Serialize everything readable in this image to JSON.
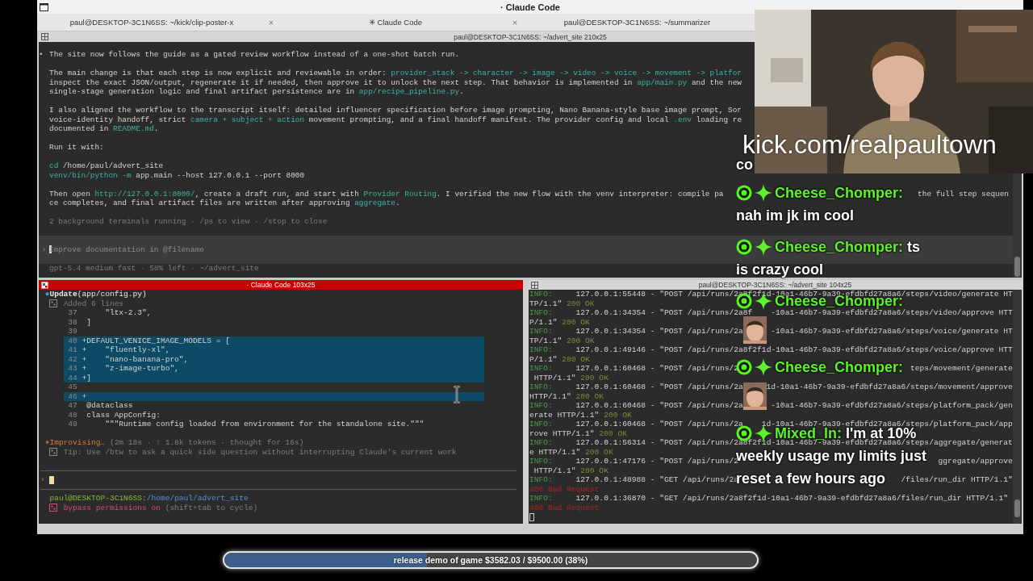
{
  "window": {
    "title": "· Claude Code"
  },
  "tabs": [
    {
      "label": "paul@DESKTOP-3C1N6SS: ~/kick/clip-poster-x",
      "close": "×"
    },
    {
      "label": "✳ Claude Code",
      "close": "×"
    },
    {
      "label": "paul@DESKTOP-3C1N6SS: ~/summarizer"
    }
  ],
  "top_pane": {
    "title": "paul@DESKTOP-3C1N6SS: ~/advert_site 210x25",
    "paragraphs": [
      [
        {
          "bullet": "•",
          "segments": [
            {
              "text": "The site now follows the guide as a gated review workflow instead of a one-shot batch run.",
              "kind": "plain"
            }
          ]
        }
      ],
      [
        {
          "segments": [
            {
              "text": "The main change is that each step is now explicit and reviewable in order: ",
              "kind": "plain"
            },
            {
              "text": "provider_stack -> character -> image -> video -> voice -> movement -> platfor",
              "kind": "accent"
            }
          ]
        },
        {
          "segments": [
            {
              "text": "inspect the exact JSON/output, regenerate it if needed, then approve it to unlock the next step. That behavior is implemented in ",
              "kind": "plain"
            },
            {
              "text": "app/main.py",
              "kind": "accent"
            },
            {
              "text": " and the new",
              "kind": "plain"
            }
          ]
        },
        {
          "segments": [
            {
              "text": "single-stage generation logic and final artifact persistence are in ",
              "kind": "plain"
            },
            {
              "text": "app/recipe_pipeline.py",
              "kind": "accent"
            },
            {
              "text": ".",
              "kind": "plain"
            }
          ]
        }
      ],
      [
        {
          "segments": [
            {
              "text": "I also aligned the workflow to the transcript itself: detailed influencer specification before image prompting, Nano Banana-style base image prompt, Sor",
              "kind": "plain"
            }
          ]
        },
        {
          "segments": [
            {
              "text": "voice-identity handoff, strict ",
              "kind": "plain"
            },
            {
              "text": "camera + subject + action",
              "kind": "accent"
            },
            {
              "text": " movement prompting, and a final handoff manifest. The provider config and local ",
              "kind": "plain"
            },
            {
              "text": ".env",
              "kind": "accent"
            },
            {
              "text": " loading re",
              "kind": "plain"
            }
          ]
        },
        {
          "segments": [
            {
              "text": "documented in ",
              "kind": "plain"
            },
            {
              "text": "README.md",
              "kind": "accent"
            },
            {
              "text": ".",
              "kind": "plain"
            }
          ]
        }
      ],
      [
        {
          "segments": [
            {
              "text": "Run it with:",
              "kind": "plain"
            }
          ]
        }
      ],
      [
        {
          "segments": [
            {
              "text": "cd",
              "kind": "accent"
            },
            {
              "text": " /home/paul/advert_site",
              "kind": "plain"
            }
          ]
        },
        {
          "segments": [
            {
              "text": "venv/bin/python -m",
              "kind": "accent"
            },
            {
              "text": " app.main --host 127.0.0.1 --port 8000",
              "kind": "plain"
            }
          ]
        }
      ],
      [
        {
          "segments": [
            {
              "text": "Then open ",
              "kind": "plain"
            },
            {
              "text": "http://127.0.0.1:8000/",
              "kind": "accent"
            },
            {
              "text": ", create a draft run, and start with ",
              "kind": "plain"
            },
            {
              "text": "Provider Routing",
              "kind": "accent"
            },
            {
              "text": ". I verified the new flow with the venv interpreter: compile pa",
              "kind": "plain"
            },
            {
              "text": "the full step sequen",
              "kind": "far"
            }
          ]
        },
        {
          "segments": [
            {
              "text": "ce completes, and final artifact files are written after approving ",
              "kind": "plain"
            },
            {
              "text": "aggregate",
              "kind": "accent"
            },
            {
              "text": ".",
              "kind": "plain"
            }
          ]
        }
      ],
      [
        {
          "segments": [
            {
              "text": "2 background terminals running · /ps to view · /stop to close",
              "kind": "dim"
            }
          ]
        }
      ]
    ],
    "prompt": {
      "marker": "›",
      "placeholder": "Improve documentation in @filename"
    },
    "status": "gpt-5.4 medium fast · 58% left · ~/advert_site"
  },
  "claude_pane": {
    "title": "· Claude Code 103x25",
    "tool_call": {
      "bullet": "●",
      "text": "**Update**(app/config.py)"
    },
    "result": "Added 6 lines",
    "diff": [
      {
        "num": "37",
        "text": "     \"ltx-2.3\",",
        "added": false
      },
      {
        "num": "38",
        "text": " ]",
        "added": false
      },
      {
        "num": "39",
        "added": false
      },
      {
        "num": "40",
        "text": "+DEFAULT_VENICE_IMAGE_MODELS = [",
        "added": true
      },
      {
        "num": "41",
        "text": "+    \"fluently-xl\",",
        "added": true
      },
      {
        "num": "42",
        "text": "+    \"nano-banana-pro\",",
        "added": true
      },
      {
        "num": "43",
        "text": "+    \"z-image-turbo\",",
        "added": true
      },
      {
        "num": "44",
        "text": "+]",
        "added": true
      },
      {
        "num": "45",
        "added": false
      },
      {
        "num": "46",
        "text": "+",
        "added": true
      },
      {
        "num": "47",
        "text": " @dataclass",
        "added": false
      },
      {
        "num": "48",
        "text": " class AppConfig:",
        "added": false
      },
      {
        "num": "49",
        "text": "     \"\"\"Runtime config loaded from environment for the standalone site.\"\"\"",
        "added": false
      }
    ],
    "activity": {
      "spinner": "✶",
      "label": "Improvising…",
      "detail": " (2m 18s · ↑ 1.8k tokens · thought for 16s)"
    },
    "tip": "Tip: Use /btw to ask a quick side question without interrupting Claude's current work",
    "prompt": {
      "marker": "›"
    },
    "shell": {
      "user_host": "paul@DESKTOP-3C1N6SS:",
      "path": "/home/paul/advert_site",
      "mode": "bypass permissions on",
      "hint": " (shift+tab to cycle)"
    }
  },
  "log_pane": {
    "title": "paul@DESKTOP-3C1N6SS: ~/advert_site 104x25",
    "rows": [
      [
        {
          "text": "INFO:",
          "kind": "level"
        },
        {
          "text": "     127.0.0.1:55448 - \"POST /api/runs/2a8f2f1d-10a1-46b7-9a39-efdbfd27a8a6/steps/video/generate HT",
          "kind": "plain"
        }
      ],
      [
        {
          "text": "TP/1.1\" ",
          "kind": "plain"
        },
        {
          "text": "200 OK",
          "kind": "ok"
        }
      ],
      [
        {
          "text": "INFO:",
          "kind": "level"
        },
        {
          "text": "     127.0.0.1:34354 - \"POST /api/runs/2a8f",
          "kind": "plain"
        },
        {
          "text": "-10a1-46b7-9a39-efdbfd27a8a6/steps/video/approve HTT",
          "kind": "far"
        }
      ],
      [
        {
          "text": "P/1.1\" ",
          "kind": "plain"
        },
        {
          "text": "200 OK",
          "kind": "ok"
        }
      ],
      [
        {
          "text": "INFO:",
          "kind": "level"
        },
        {
          "text": "     127.0.0.1:34354 - \"POST /api/runs/2a",
          "kind": "plain"
        },
        {
          "text": "-10a1-46b7-9a39-efdbfd27a8a6/steps/voice/generate HT",
          "kind": "far"
        }
      ],
      [
        {
          "text": "TP/1.1\" ",
          "kind": "plain"
        },
        {
          "text": "200 OK",
          "kind": "ok"
        }
      ],
      [
        {
          "text": "INFO:",
          "kind": "level"
        },
        {
          "text": "     127.0.0.1:49146 - \"POST /api/runs/2a8f2f1d-10a1-46b7-9a39-efdbfd27a8a6/steps/voice/approve HTT",
          "kind": "plain"
        }
      ],
      [
        {
          "text": "P/1.1\" ",
          "kind": "plain"
        },
        {
          "text": "200 OK",
          "kind": "ok"
        }
      ],
      [
        {
          "text": "INFO:",
          "kind": "level"
        },
        {
          "text": "     127.0.0.1:60468 - \"POST /api/runs/2",
          "kind": "plain"
        },
        {
          "text": "teps/movement/generate",
          "kind": "far"
        }
      ],
      [
        {
          "text": " HTTP/1.1\" ",
          "kind": "plain"
        },
        {
          "text": "200 OK",
          "kind": "ok"
        }
      ],
      [
        {
          "text": "INFO:",
          "kind": "level"
        },
        {
          "text": "     127.0.0.1:60468 - \"POST /api/runs/2a",
          "kind": "plain"
        },
        {
          "text": "1d-10a1-46b7-9a39-efdbfd27a8a6/steps/movement/approve",
          "kind": "far"
        }
      ],
      [
        {
          "text": "HTTP/1.1\" ",
          "kind": "plain"
        },
        {
          "text": "200 OK",
          "kind": "ok"
        }
      ],
      [
        {
          "text": "INFO:",
          "kind": "level"
        },
        {
          "text": "     127.0.0.1:60468 - \"POST /api/runs/2a",
          "kind": "plain"
        },
        {
          "text": "-10a1-46b7-9a39-efdbfd27a8a6/steps/platform_pack/gen",
          "kind": "far"
        }
      ],
      [
        {
          "text": "erate HTTP/1.1\" ",
          "kind": "plain"
        },
        {
          "text": "200 OK",
          "kind": "ok"
        }
      ],
      [
        {
          "text": "INFO:",
          "kind": "level"
        },
        {
          "text": "     127.0.0.1:60468 - \"POST /api/runs/2a",
          "kind": "plain"
        },
        {
          "text": "1d-10a1-46b7-9a39-efdbfd27a8a6/steps/platform_pack/app",
          "kind": "far"
        }
      ],
      [
        {
          "text": "rove HTTP/1.1\" ",
          "kind": "plain"
        },
        {
          "text": "200 OK",
          "kind": "ok"
        }
      ],
      [
        {
          "text": "INFO:",
          "kind": "level"
        },
        {
          "text": "     127.0.0.1:56314 - \"POST /api/runs/2a8f2f1d-10a1-46b7-9a39-efdbfd27a8a6/steps/aggregate/generat",
          "kind": "plain"
        }
      ],
      [
        {
          "text": "e HTTP/1.1\" ",
          "kind": "plain"
        },
        {
          "text": "200 OK",
          "kind": "ok"
        }
      ],
      [
        {
          "text": "INFO:",
          "kind": "level"
        },
        {
          "text": "     127.0.0.1:47176 - \"POST /api/runs/2",
          "kind": "plain"
        },
        {
          "text": "ggregate/approve",
          "kind": "far"
        }
      ],
      [
        {
          "text": " HTTP/1.1\" ",
          "kind": "plain"
        },
        {
          "text": "200 OK",
          "kind": "ok"
        }
      ],
      [
        {
          "text": "INFO:",
          "kind": "level"
        },
        {
          "text": "     127.0.0.1:48988 - \"GET /api/runs/2a",
          "kind": "plain"
        },
        {
          "text": "/files/run_dir HTTP/1.1\"",
          "kind": "far"
        }
      ],
      [
        {
          "text": "400 Bad Request",
          "kind": "error"
        }
      ],
      [
        {
          "text": "INFO:",
          "kind": "level"
        },
        {
          "text": "     127.0.0.1:36870 - \"GET /api/runs/2a8f2f1d-10a1-46b7-9a39-efdbfd27a8a6/files/run_dir HTTP/1.1\"",
          "kind": "plain"
        }
      ],
      [
        {
          "text": "400 Bad Request",
          "kind": "error"
        }
      ]
    ],
    "cursor_visible": true
  },
  "chat": {
    "partial": "co",
    "messages": [
      {
        "user": "Cheese_Chomper:",
        "kind": "text",
        "lines": [
          "nah im jk im cool"
        ]
      },
      {
        "user": "Cheese_Chomper:",
        "kind": "text",
        "inline_text": "ts",
        "lines": [
          "is crazy cool"
        ]
      },
      {
        "user": "Cheese_Chomper:",
        "kind": "emote"
      },
      {
        "user": "Cheese_Chomper:",
        "kind": "emote"
      },
      {
        "user": "Mixed_In:",
        "kind": "text",
        "inline_text": "I'm at 10%",
        "lines": [
          "weekly usage my limits just",
          "reset a few hours ago"
        ]
      }
    ]
  },
  "webcam": {
    "caption": "kick.com/realpaultown"
  },
  "goal": {
    "text": "release demo of game $3582.03 / $9500.00 (38%)",
    "level": 0.38
  }
}
